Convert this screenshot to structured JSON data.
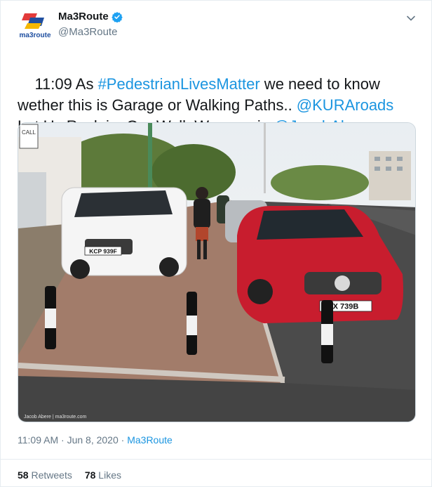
{
  "author": {
    "display_name": "Ma3Route",
    "handle": "@Ma3Route",
    "verified": true,
    "logo_text": "ma3route"
  },
  "tweet": {
    "text_parts": [
      {
        "text": "11:09 As ",
        "link": false
      },
      {
        "text": "#PedestrianLivesMatter",
        "link": true
      },
      {
        "text": " we need to know wether this is Garage or Walking Paths.. ",
        "link": false
      },
      {
        "text": "@KURAroads",
        "link": true
      },
      {
        "text": " Let Us Reclaim Our Walk Ways.   via ",
        "link": false
      },
      {
        "text": "@JacobAbere",
        "link": true
      }
    ]
  },
  "media": {
    "plate_left": "KCP 939F",
    "plate_right": "X 739B",
    "shop_sign": "CALL",
    "watermark": "Jacob Abere | ma3route.com"
  },
  "meta": {
    "time": "11:09 AM",
    "separator": " · ",
    "date": "Jun 8, 2020",
    "source": "Ma3Route"
  },
  "stats": {
    "retweets_count": "58",
    "retweets_label": "Retweets",
    "likes_count": "78",
    "likes_label": "Likes"
  },
  "colors": {
    "link": "#1b95e0",
    "verified": "#1da1f2",
    "text": "#14171a",
    "secondary": "#657786"
  },
  "icons": [
    "verified-badge-icon",
    "chevron-down-icon"
  ]
}
